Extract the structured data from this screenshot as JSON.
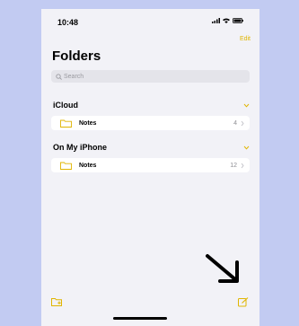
{
  "status_bar": {
    "time": "10:48"
  },
  "header": {
    "edit_label": "Edit",
    "title": "Folders"
  },
  "search": {
    "placeholder": "Search"
  },
  "sections": [
    {
      "label": "iCloud",
      "folders": [
        {
          "name": "Notes",
          "count": "4"
        }
      ]
    },
    {
      "label": "On My iPhone",
      "folders": [
        {
          "name": "Notes",
          "count": "12"
        }
      ]
    }
  ],
  "colors": {
    "accent": "#e0b500",
    "background": "#f2f2f7",
    "page_bg": "#c2cbf2"
  },
  "icons": {
    "new_folder": "new-folder-icon",
    "compose": "compose-icon",
    "folder": "folder-icon",
    "chevron_right": "chevron-right-icon",
    "chevron_down": "chevron-down-icon"
  }
}
